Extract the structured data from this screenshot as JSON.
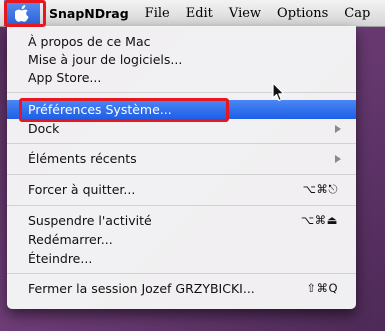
{
  "menubar": {
    "apple_icon": "apple-logo-icon",
    "items": [
      "SnapNDrag",
      "File",
      "Edit",
      "View",
      "Options",
      "Cap"
    ]
  },
  "apple_menu": {
    "items": [
      {
        "label": "À propos de ce Mac"
      },
      {
        "label": "Mise à jour de logiciels..."
      },
      {
        "label": "App Store..."
      },
      {
        "label": "Préférences Système...",
        "highlighted": true
      },
      {
        "label": "Dock",
        "submenu": true
      },
      {
        "label": "Éléments récents",
        "submenu": true
      },
      {
        "label": "Forcer à quitter...",
        "shortcut": "⌥⌘⎋"
      },
      {
        "label": "Suspendre l'activité",
        "shortcut": "⌥⌘⏏"
      },
      {
        "label": "Redémarrer..."
      },
      {
        "label": "Éteindre..."
      },
      {
        "label": "Fermer la session Jozef GRZYBICKI...",
        "shortcut": "⇧⌘Q"
      }
    ]
  },
  "colors": {
    "highlight": "#2a6ae8",
    "annotation_red": "#e8161e",
    "desktop": "#5a2f63"
  }
}
